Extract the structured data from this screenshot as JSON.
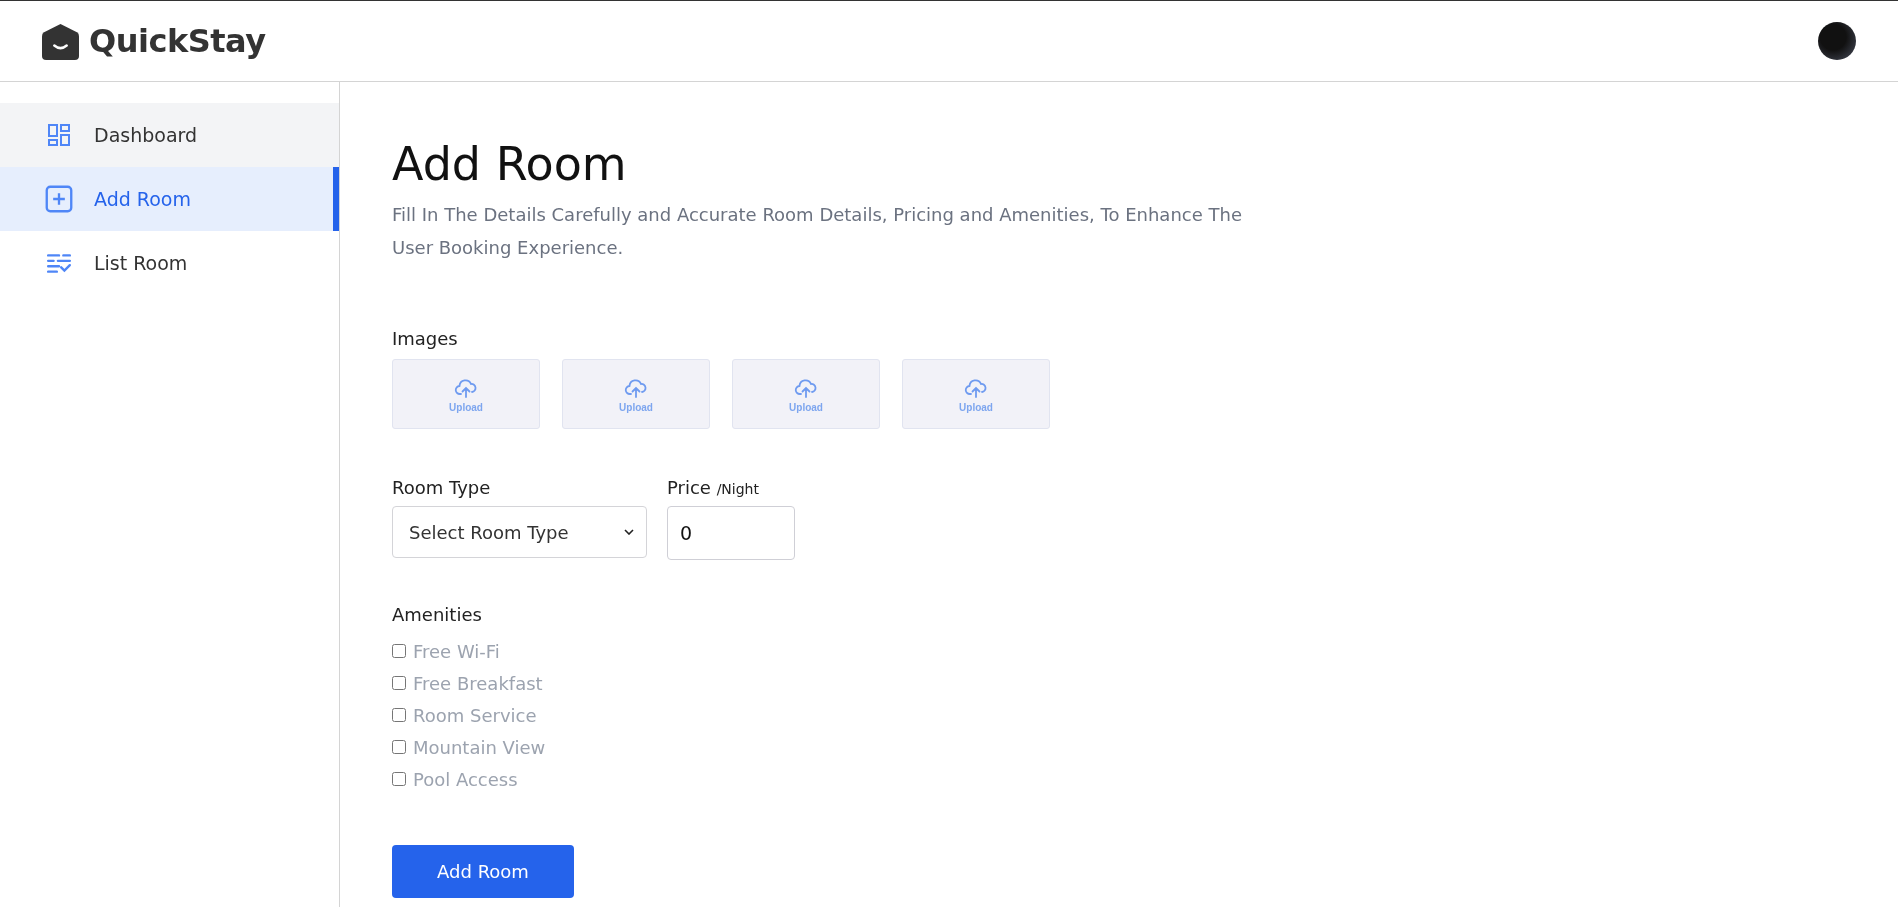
{
  "header": {
    "brand": "QuickStay"
  },
  "sidebar": {
    "items": [
      {
        "label": "Dashboard",
        "kind": "dashboard",
        "selected": false,
        "hovered": true
      },
      {
        "label": "Add Room",
        "kind": "add",
        "selected": true,
        "hovered": false
      },
      {
        "label": "List Room",
        "kind": "list",
        "selected": false,
        "hovered": false
      }
    ]
  },
  "page": {
    "title": "Add Room",
    "subtitle": "Fill In The Details Carefully and Accurate Room Details, Pricing and Amenities, To Enhance The User Booking Experience."
  },
  "images": {
    "label": "Images",
    "slots": [
      "Upload",
      "Upload",
      "Upload",
      "Upload"
    ]
  },
  "room_type": {
    "label": "Room Type",
    "value": "Select Room Type"
  },
  "price": {
    "label": "Price",
    "unit": "/Night",
    "value": "0"
  },
  "amenities": {
    "label": "Amenities",
    "items": [
      {
        "label": "Free Wi-Fi",
        "checked": false
      },
      {
        "label": "Free Breakfast",
        "checked": false
      },
      {
        "label": "Room Service",
        "checked": false
      },
      {
        "label": "Mountain View",
        "checked": false
      },
      {
        "label": "Pool Access",
        "checked": false
      }
    ]
  },
  "submit": {
    "label": "Add Room"
  }
}
